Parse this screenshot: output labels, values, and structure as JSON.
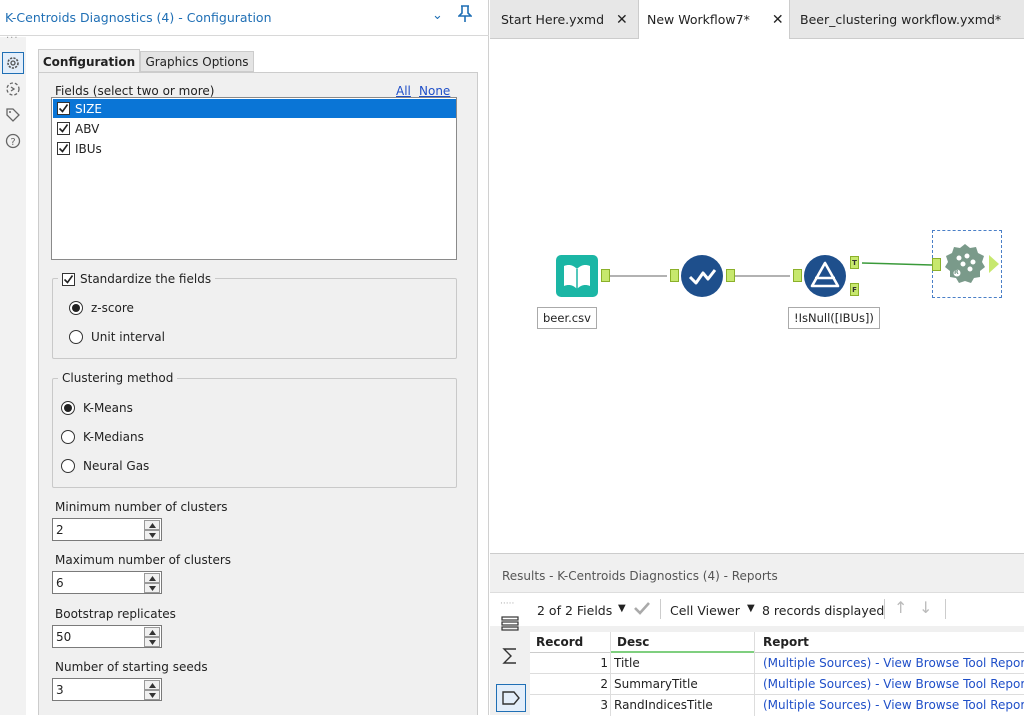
{
  "panel": {
    "title": "K-Centroids Diagnostics (4) - Configuration"
  },
  "tabs": {
    "config": "Configuration",
    "graphics": "Graphics Options"
  },
  "fields": {
    "label": "Fields (select two or more)",
    "all": "All",
    "none": "None",
    "items": [
      "SIZE",
      "ABV",
      "IBUs"
    ]
  },
  "standardize": {
    "label": "Standardize the fields",
    "options": [
      "z-score",
      "Unit interval"
    ],
    "selected": 0
  },
  "clustering": {
    "label": "Clustering method",
    "options": [
      "K-Means",
      "K-Medians",
      "Neural Gas"
    ],
    "selected": 0
  },
  "min_clusters": {
    "label": "Minimum number of clusters",
    "value": "2"
  },
  "max_clusters": {
    "label": "Maximum number of clusters",
    "value": "6"
  },
  "bootstrap": {
    "label": "Bootstrap replicates",
    "value": "50"
  },
  "seeds": {
    "label": "Number of starting seeds",
    "value": "3"
  },
  "workflow_tabs": [
    "Start Here.yxmd",
    "New Workflow7*",
    "Beer_clustering workflow.yxmd*"
  ],
  "canvas": {
    "input_label": "beer.csv",
    "filter_label": "!IsNull([IBUs])",
    "t_anchor": "T",
    "f_anchor": "F",
    "r_badge": "R"
  },
  "results": {
    "title": "Results - K-Centroids Diagnostics (4) - Reports",
    "fields": "2 of 2 Fields",
    "viewer": "Cell Viewer",
    "records": "8 records displayed",
    "columns": [
      "Record",
      "Desc",
      "Report"
    ],
    "rows": [
      [
        "1",
        "Title",
        "(Multiple Sources) - View Browse Tool Report"
      ],
      [
        "2",
        "SummaryTitle",
        "(Multiple Sources) - View Browse Tool Report"
      ],
      [
        "3",
        "RandIndicesTitle",
        "(Multiple Sources) - View Browse Tool Report"
      ]
    ]
  },
  "colors": {
    "accent": "#1f6fb5",
    "selection": "#0a75d6",
    "anchor": "#c7e86e"
  }
}
